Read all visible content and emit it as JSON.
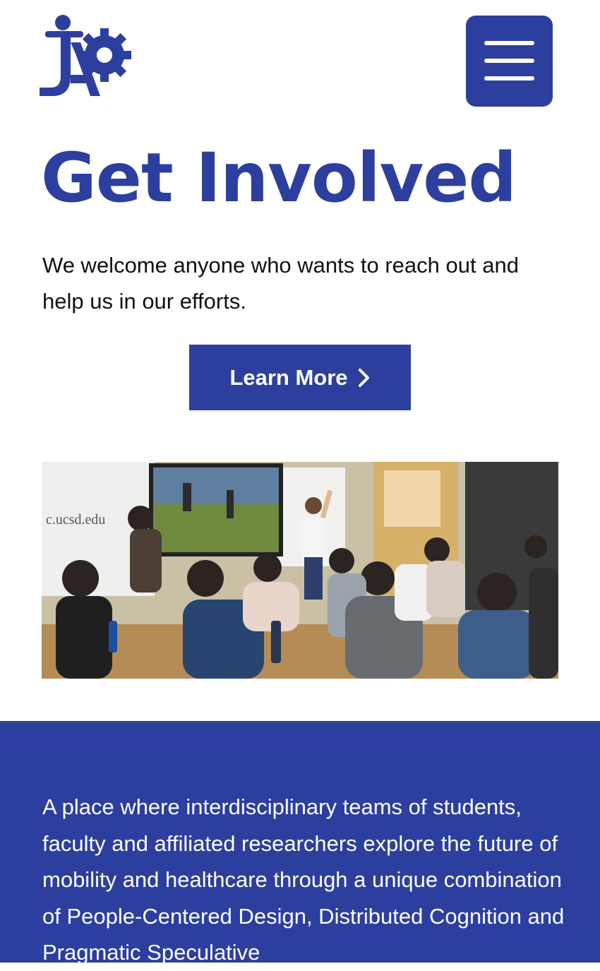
{
  "header": {
    "logo_name": "jap-logo",
    "menu_icon": "hamburger-icon"
  },
  "hero": {
    "title": "Get Involved",
    "intro": "We welcome anyone who wants to reach out and help us in our efforts.",
    "cta_label": "Learn More",
    "cta_icon": "chevron-right-icon"
  },
  "photo": {
    "board_text": "c.ucsd.edu"
  },
  "about": {
    "text": "A place where interdisciplinary teams of students, faculty and affiliated researchers explore the future of mobility and healthcare through a unique combination of People-Centered Design, Distributed Cognition and Pragmatic Speculative"
  },
  "colors": {
    "brand": "#2d3f9e",
    "text": "#111111",
    "background": "#ffffff"
  }
}
